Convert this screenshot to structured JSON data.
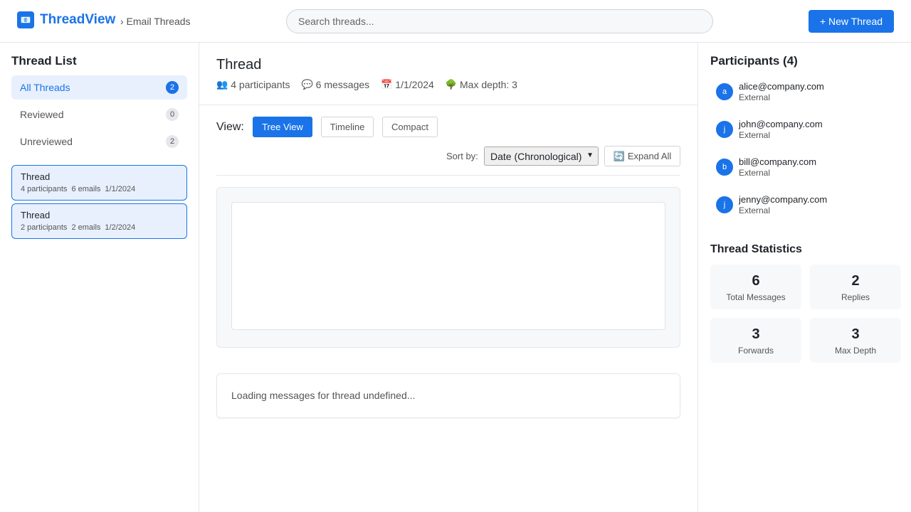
{
  "header": {
    "logo_icon": "📧",
    "app_name": "ThreadView",
    "breadcrumb": "› Email Threads",
    "search_placeholder": "Search threads...",
    "new_thread_label": "+ New Thread"
  },
  "sidebar": {
    "title": "Thread List",
    "filters": [
      {
        "label": "All Threads",
        "count": "2",
        "active": true
      },
      {
        "label": "Reviewed",
        "count": "0",
        "active": false
      },
      {
        "label": "Unreviewed",
        "count": "2",
        "active": false
      }
    ],
    "threads": [
      {
        "title": "Thread",
        "participants": "4 participants",
        "emails": "6 emails",
        "date": "1/1/2024"
      },
      {
        "title": "Thread",
        "participants": "2 participants",
        "emails": "2 emails",
        "date": "1/2/2024"
      }
    ]
  },
  "main": {
    "title": "Thread",
    "meta": {
      "participants": "4 participants",
      "participants_icon": "👥",
      "messages": "6 messages",
      "messages_icon": "💬",
      "date": "1/1/2024",
      "date_icon": "📅",
      "depth": "Max depth: 3",
      "depth_icon": "🌳"
    },
    "view_label": "View:",
    "views": [
      "Tree View",
      "Timeline",
      "Compact"
    ],
    "active_view": "Tree View",
    "sort_label": "Sort by:",
    "sort_value": "Date (Chronological)",
    "expand_icon": "🔄",
    "expand_label": "Expand All",
    "loading_text": "Loading messages for thread undefined..."
  },
  "participants": {
    "title": "Participants (4)",
    "items": [
      {
        "initial": "a",
        "email": "alice@company.com",
        "role": "External"
      },
      {
        "initial": "j",
        "email": "john@company.com",
        "role": "External"
      },
      {
        "initial": "b",
        "email": "bill@company.com",
        "role": "External"
      },
      {
        "initial": "j",
        "email": "jenny@company.com",
        "role": "External"
      }
    ]
  },
  "stats": {
    "title": "Thread Statistics",
    "items": [
      {
        "value": "6",
        "label": "Total Messages"
      },
      {
        "value": "2",
        "label": "Replies"
      },
      {
        "value": "3",
        "label": "Forwards"
      },
      {
        "value": "3",
        "label": "Max Depth"
      }
    ]
  },
  "colors": {
    "accent": "#1a73e8",
    "active_bg": "#e8f0fe"
  }
}
